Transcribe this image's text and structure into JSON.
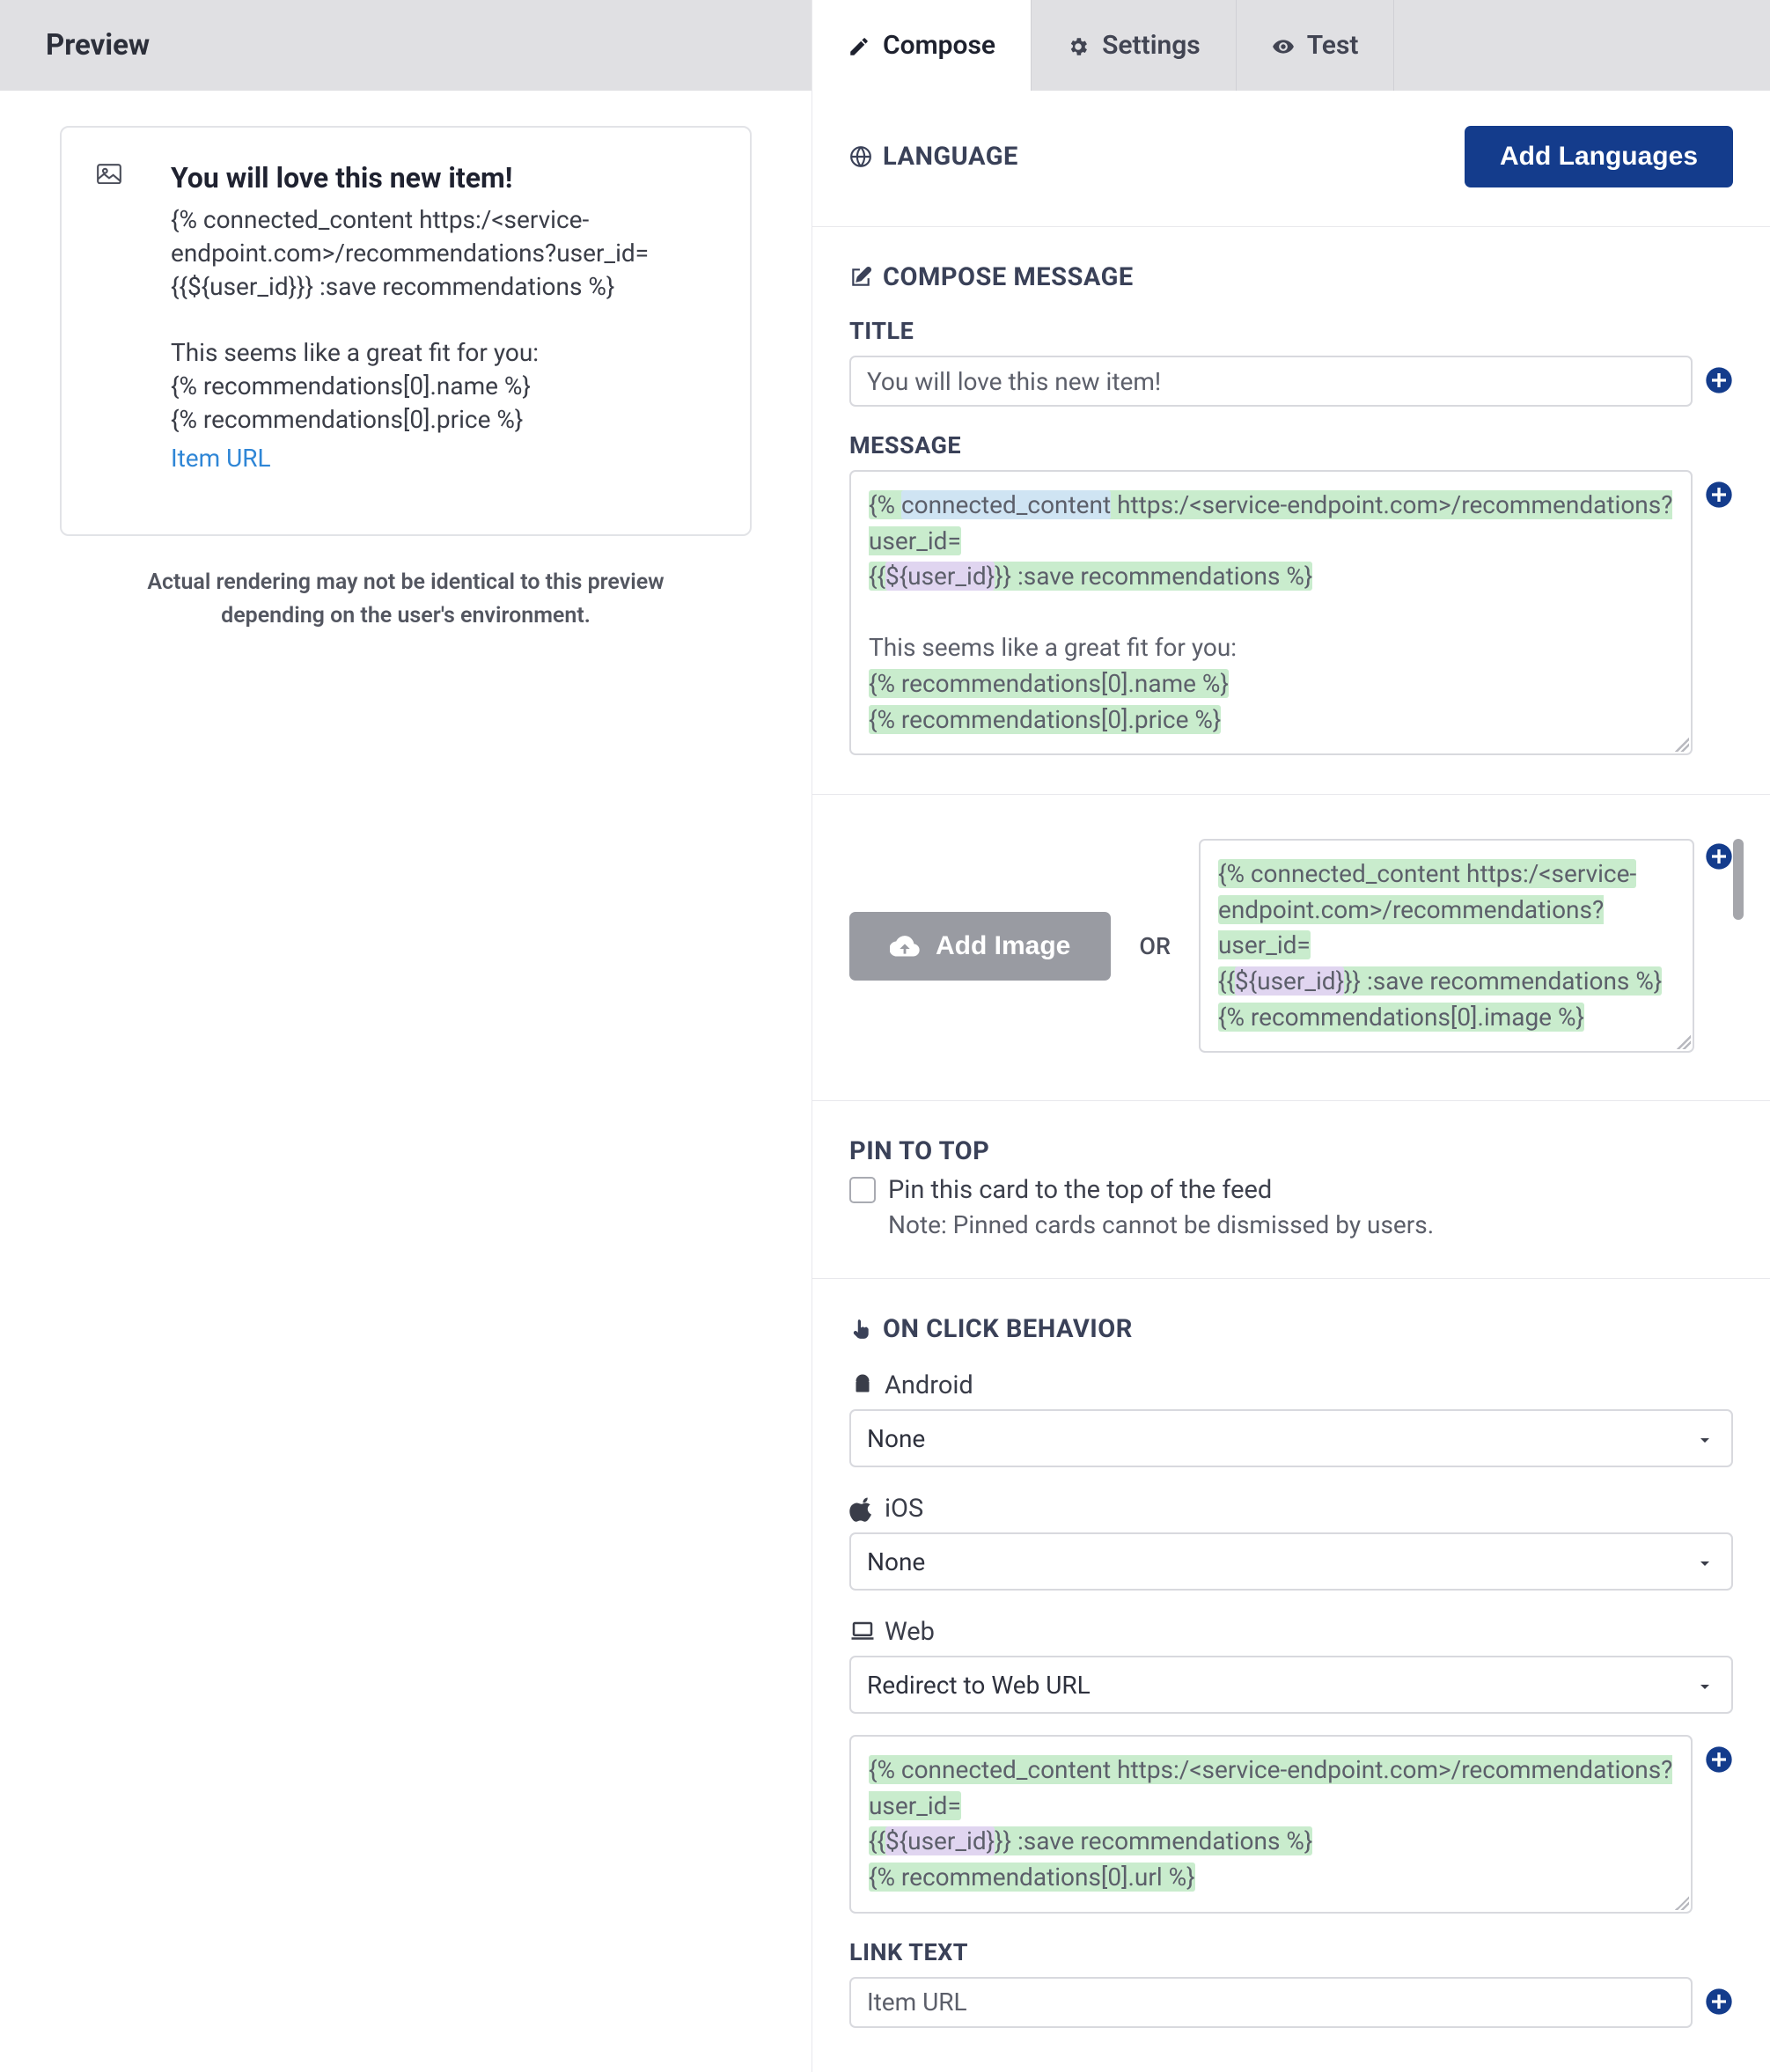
{
  "left": {
    "header": "Preview",
    "card": {
      "title": "You will love this new item!",
      "body": "{% connected_content https:/<service-endpoint.com>/recommendations?user_id={{${user_id}}} :save recommendations %}\n\nThis seems like a great fit for you:\n{% recommendations[0].name %}\n{% recommendations[0].price %}",
      "link": "Item URL"
    },
    "note": "Actual rendering may not be identical to this preview depending on the user's environment."
  },
  "tabs": {
    "compose": "Compose",
    "settings": "Settings",
    "test": "Test"
  },
  "language": {
    "title": "LANGUAGE",
    "add_btn": "Add Languages"
  },
  "compose": {
    "heading": "COMPOSE MESSAGE",
    "title_label": "TITLE",
    "title_value": "You will love this new item!",
    "message_label": "MESSAGE",
    "msg_parts": {
      "p1a": "{% ",
      "p1b": "connected_content",
      "p1c": " https:/<service-endpoint.com>/recommendations?user_id=",
      "p2a": "{{",
      "p2b": "${user_id}",
      "p2c": "}} :save recommendations %}",
      "p3": "This seems like a great fit for you:",
      "p4": "{% recommendations[0].name %}",
      "p5": "{% recommendations[0].price %}"
    }
  },
  "image": {
    "btn": "Add Image",
    "or": "OR",
    "parts": {
      "l1": "{% connected_content https:/<service-",
      "l2": "endpoint.com>/recommendations?user_id=",
      "l3a": "{{",
      "l3b": "${user_id}",
      "l3c": "}} :save recommendations %}",
      "l4": "{% recommendations[0].image %}"
    }
  },
  "pin": {
    "title": "PIN TO TOP",
    "label": "Pin this card to the top of the feed",
    "note": "Note: Pinned cards cannot be dismissed by users."
  },
  "click": {
    "title": "ON CLICK BEHAVIOR",
    "android": "Android",
    "android_val": "None",
    "ios": "iOS",
    "ios_val": "None",
    "web": "Web",
    "web_val": "Redirect to Web URL",
    "web_url_parts": {
      "l1": "{% connected_content https:/<service-endpoint.com>/recommendations?user_id=",
      "l2a": "{{",
      "l2b": "${user_id}",
      "l2c": "}} :save recommendations %}",
      "l3": "{% recommendations[0].url %}"
    },
    "link_text_label": "LINK TEXT",
    "link_text_value": "Item URL"
  }
}
